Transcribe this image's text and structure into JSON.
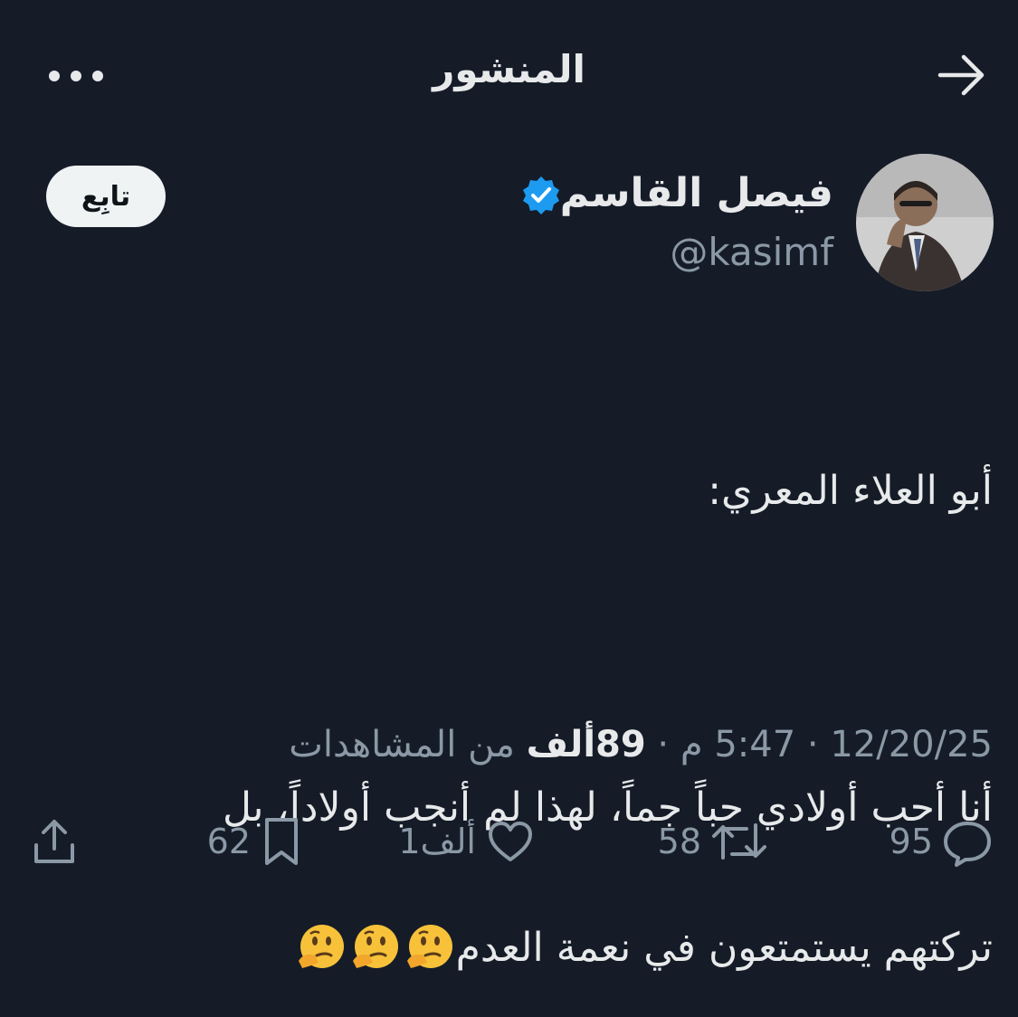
{
  "header": {
    "title": "المنشور"
  },
  "author": {
    "name": "فيصل القاسم",
    "handle": "@kasimf",
    "follow_label": "تابِع"
  },
  "tweet": {
    "line1": "أبو العلاء المعري:",
    "line2": "أنا أحب أولادي حباً جماً، لهذا لم أنجب أولاداً، بل",
    "line3": "تركتهم يستمتعون في نعمة العدم",
    "emojis": [
      "thinking-face",
      "thinking-face",
      "thinking-face"
    ]
  },
  "meta": {
    "date": "12/20/25",
    "sep1": " · ",
    "time": "5:47 م",
    "sep2": " · ",
    "views_count": "89ألف",
    "views_label": " من المشاهدات"
  },
  "actions": {
    "replies": "95",
    "reposts": "58",
    "likes": "1ألف",
    "bookmarks": "62"
  },
  "colors": {
    "background": "#151c28",
    "text": "#e7e9ea",
    "muted": "#8b98a5",
    "verified": "#1d9bf0"
  }
}
